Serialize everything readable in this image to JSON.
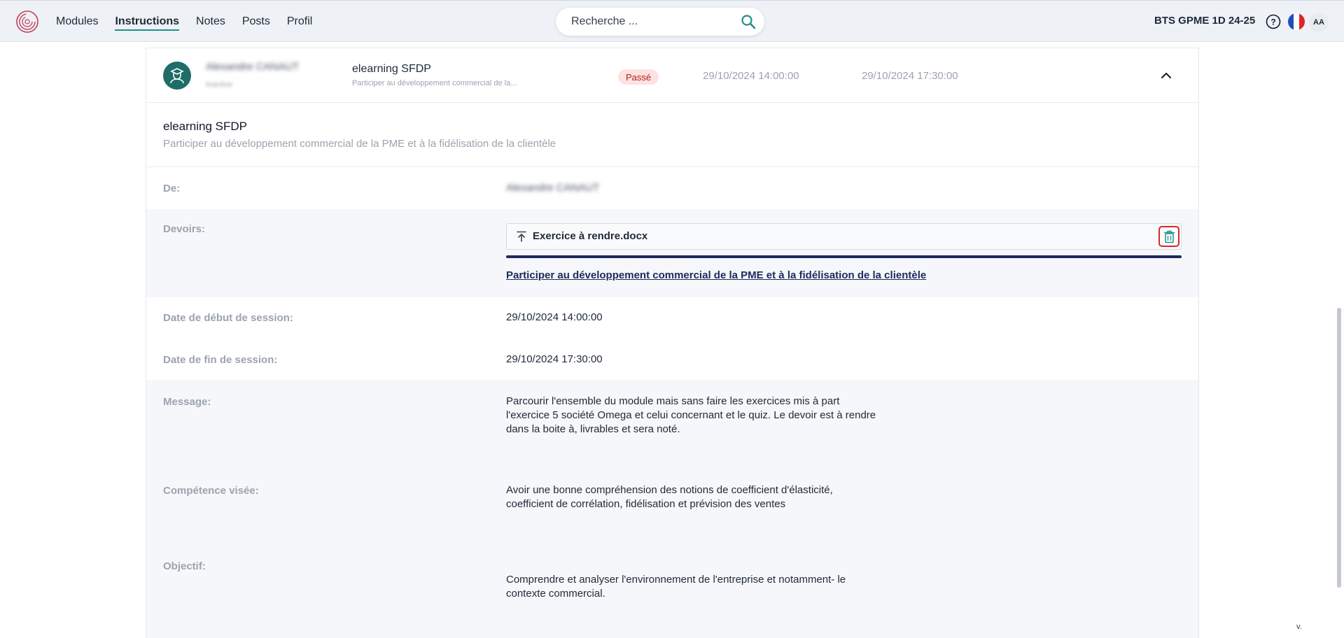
{
  "nav": {
    "items": [
      {
        "label": "Modules"
      },
      {
        "label": "Instructions"
      },
      {
        "label": "Notes"
      },
      {
        "label": "Posts"
      },
      {
        "label": "Profil"
      }
    ],
    "active": "Instructions"
  },
  "search": {
    "placeholder": "Recherche ..."
  },
  "header": {
    "class_label": "BTS GPME 1D 24-25",
    "avatar_initials": "AA"
  },
  "row": {
    "author_name": "Alexandre CANAUT",
    "author_role": "Inactive",
    "title": "elearning SFDP",
    "subtitle": "Participer au développement commercial de la...",
    "status": "Passé",
    "start": "29/10/2024 14:00:00",
    "end": "29/10/2024 17:30:00"
  },
  "detail": {
    "title": "elearning SFDP",
    "subtitle": "Participer au développement commercial de la PME et à la fidélisation de la clientèle",
    "fields": {
      "de": {
        "label": "De:",
        "value": "Alexandre CANAUT"
      },
      "devoirs": {
        "label": "Devoirs:",
        "file_name": "Exercice à rendre.docx",
        "competence_link": "Participer au développement commercial de la PME et à la fidélisation de la clientèle",
        "upload_progress": 1.0
      },
      "date_debut": {
        "label": "Date de début de session:",
        "value": "29/10/2024 14:00:00"
      },
      "date_fin": {
        "label": "Date de fin de session:",
        "value": "29/10/2024 17:30:00"
      },
      "message": {
        "label": "Message:",
        "lines": [
          "Parcourir l'ensemble du module mais sans faire les exercices mis à part",
          "l'exercice 5 société Omega et celui concernant et le quiz. Le devoir est à rendre",
          "dans la boite à, livrables et sera noté."
        ]
      },
      "competence": {
        "label": "Compétence visée:",
        "lines": [
          "Avoir une bonne compréhension des notions de coefficient d'élasticité,",
          "coefficient de corrélation, fidélisation et prévision des ventes"
        ]
      },
      "objectif": {
        "label": "Objectif:",
        "lines": [
          "Comprendre et analyser l'environnement de l'entreprise et notamment- le",
          "contexte commercial."
        ]
      }
    }
  },
  "footer": {
    "version": "v."
  },
  "colors": {
    "accent": "#1e8f8a",
    "primary_dark": "#1e2a5a",
    "danger": "#dc2626",
    "badge_bg": "#fde2e2"
  }
}
